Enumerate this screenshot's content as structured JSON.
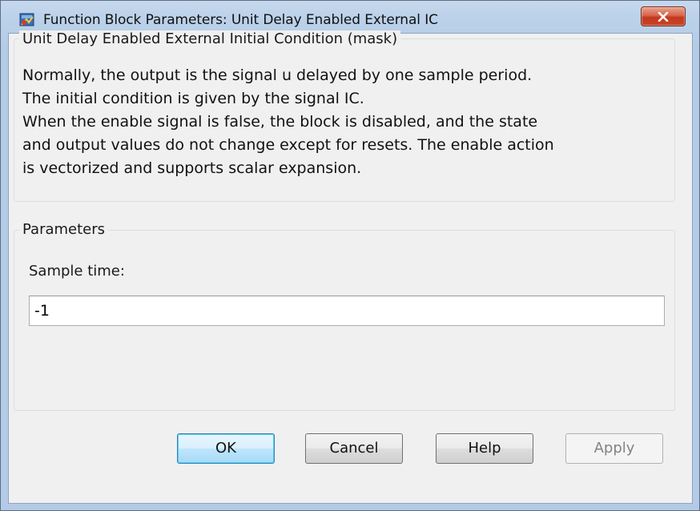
{
  "window": {
    "title": "Function Block Parameters: Unit Delay Enabled External IC",
    "icon": "simulink-block-icon",
    "close_icon": "close-x-icon"
  },
  "description": {
    "heading": "Unit Delay Enabled External Initial Condition (mask)",
    "lines": [
      "Normally, the output is the signal u delayed by one sample period.",
      "The initial condition is given by the signal IC.",
      "When the enable signal is false, the block is disabled, and the state",
      "and output values do not change except for resets.  The enable action",
      "is vectorized and supports scalar expansion."
    ]
  },
  "parameters": {
    "heading": "Parameters",
    "sample_time_label": "Sample time:",
    "sample_time_value": "-1"
  },
  "buttons": {
    "ok": "OK",
    "cancel": "Cancel",
    "help": "Help",
    "apply": "Apply"
  },
  "colors": {
    "close_button": "#c9452b",
    "default_button_border": "#3c7fb1",
    "dialog_background": "#f0f0f0"
  }
}
